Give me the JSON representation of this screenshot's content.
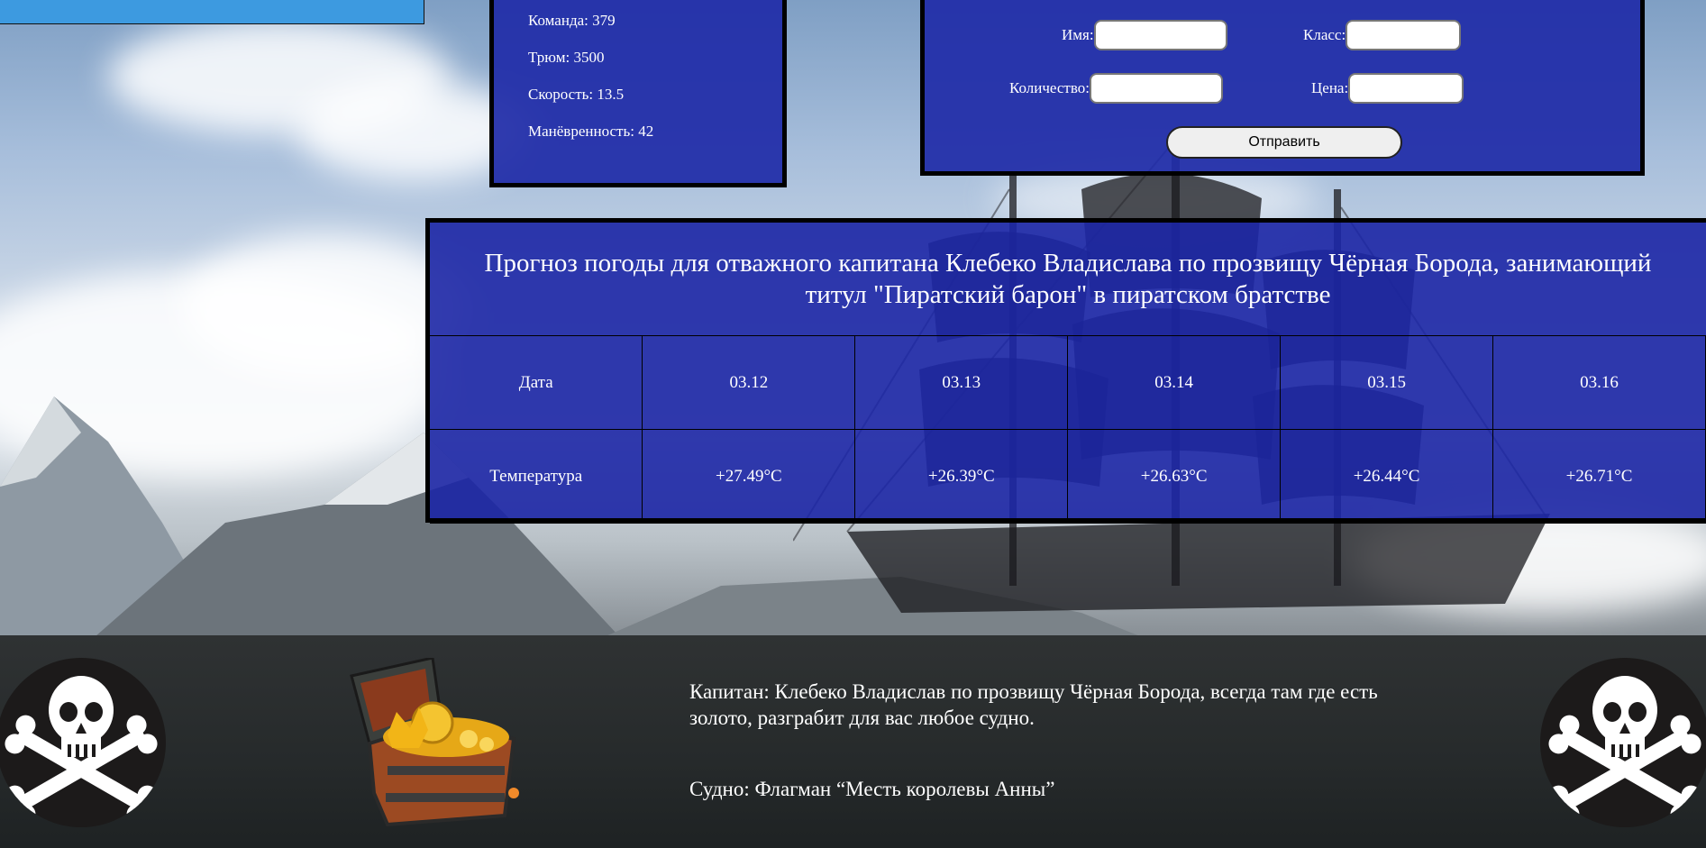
{
  "stats": {
    "crew": "Команда: 379",
    "hold": "Трюм: 3500",
    "speed": "Скорость: 13.5",
    "maneuverability": "Манёвренность: 42"
  },
  "form": {
    "name_label": "Имя:",
    "class_label": "Класс:",
    "quantity_label": "Количество:",
    "price_label": "Цена:",
    "submit_label": "Отправить"
  },
  "weather": {
    "title": "Прогноз погоды для отважного капитана Клебеко Владислава по прозвищу Чёрная Борода, занимающий титул \"Пиратский барон\" в пиратском братстве",
    "date_label": "Дата",
    "temp_label": "Температура",
    "dates": [
      "03.12",
      "03.13",
      "03.14",
      "03.15",
      "03.16"
    ],
    "temperatures": [
      "+27.49°C",
      "+26.39°C",
      "+26.63°C",
      "+26.44°C",
      "+26.71°C"
    ]
  },
  "footer": {
    "captain": "Капитан: Клебеко Владислав по прозвищу Чёрная Борода, всегда там где есть золото, разграбит для вас любое судно.",
    "ship": "Судно: Флагман “Месть королевы Анны”"
  },
  "colors": {
    "panel": "#202ca8",
    "top_bar": "#3d9ae0",
    "footer": "#2b2e2f"
  },
  "icons": [
    "jolly-roger-icon",
    "treasure-chest-icon"
  ]
}
